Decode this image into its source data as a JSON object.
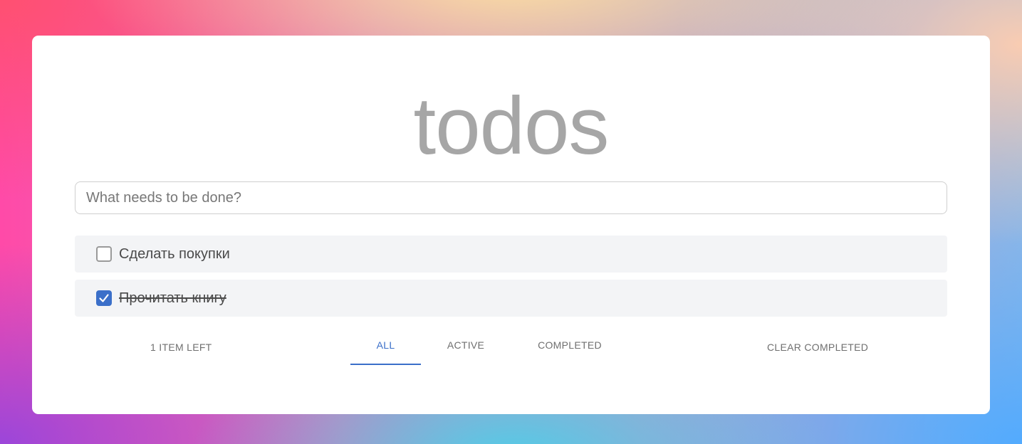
{
  "app": {
    "title": "todos"
  },
  "new_todo": {
    "placeholder": "What needs to be done?",
    "value": ""
  },
  "todos": [
    {
      "text": "Сделать покупки",
      "completed": false
    },
    {
      "text": "Прочитать книгу",
      "completed": true
    }
  ],
  "footer": {
    "items_left": "1 item left",
    "filters": [
      {
        "label": "All",
        "selected": true
      },
      {
        "label": "Active",
        "selected": false
      },
      {
        "label": "Completed",
        "selected": false
      }
    ],
    "clear_completed": "Clear completed"
  },
  "colors": {
    "accent": "#3b6fc9",
    "title": "#a6a6a6",
    "item_background": "#f3f4f6"
  },
  "icons": {
    "checkbox_checked": "check-icon"
  }
}
